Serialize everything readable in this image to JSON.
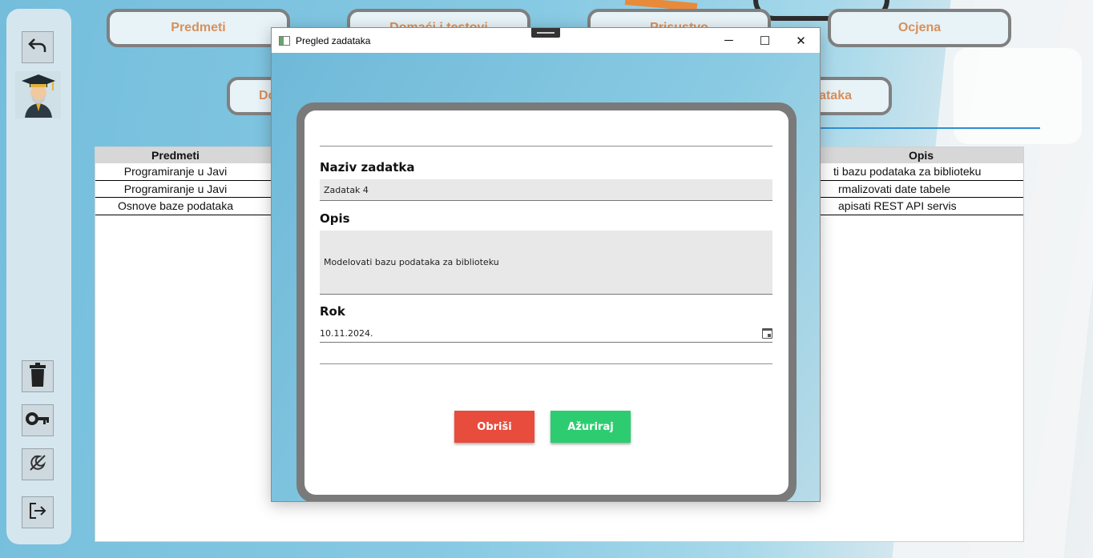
{
  "nav": {
    "row1": [
      "Predmeti",
      "Domaći i testovi",
      "Prisustvo",
      "Ocjena"
    ],
    "row2_left": "Do",
    "row2_right": "ataka"
  },
  "sidebar": {
    "items": [
      {
        "name": "undo-icon"
      },
      {
        "name": "avatar"
      },
      {
        "name": "trash-icon"
      },
      {
        "name": "key-icon"
      },
      {
        "name": "theme-toggle-icon"
      },
      {
        "name": "logout-icon"
      }
    ]
  },
  "table": {
    "headers": {
      "left": "Predmeti",
      "right": "Opis"
    },
    "rows": [
      {
        "left": "Programiranje u Javi",
        "right": "ti bazu podataka za biblioteku"
      },
      {
        "left": "Programiranje u Javi",
        "right": "rmalizovati date tabele"
      },
      {
        "left": "Osnove baze podataka",
        "right": "apisati REST API servis"
      }
    ]
  },
  "window": {
    "title": "Pregled zadataka",
    "controls": {
      "minimize": "─",
      "maximize": "☐",
      "close": "✕"
    }
  },
  "form": {
    "name_label": "Naziv zadatka",
    "name_value": "Zadatak 4",
    "desc_label": "Opis",
    "desc_value": "Modelovati bazu podataka za biblioteku",
    "due_label": "Rok",
    "due_value": "10.11.2024.",
    "delete_button": "Obriši",
    "update_button": "Ažuriraj"
  },
  "colors": {
    "nav_text": "#d8905a",
    "delete": "#e74c3c",
    "update": "#2ecc71"
  }
}
